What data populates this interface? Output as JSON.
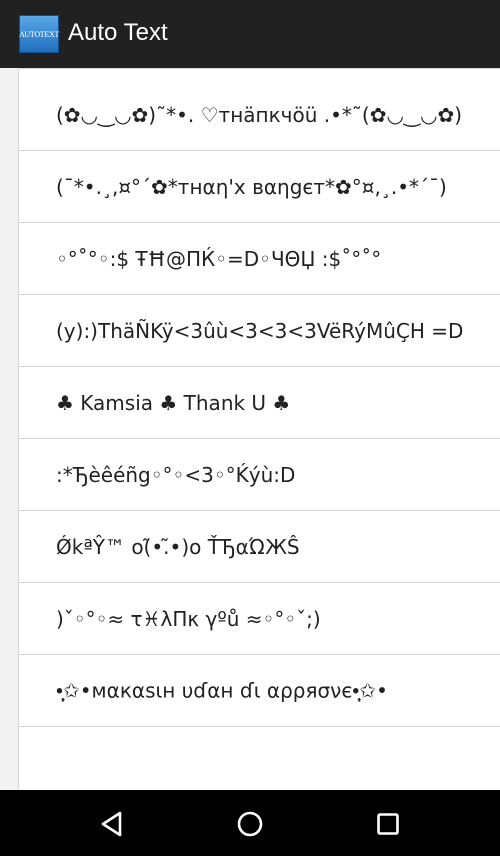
{
  "app": {
    "title": "Auto Text",
    "icon_label": "AUTOTEXT"
  },
  "items": [
    {
      "text": "(✿◡‿◡✿)˜*•. ♡тнäпкчöü .•*˜(✿◡‿◡✿)"
    },
    {
      "text": "(¯*•.¸,¤°´✿*тнαη'x вαηgєт*✿°¤,¸.•*´¯)"
    },
    {
      "text": "◦°˚°◦:$ ŦĦ@ΠЌ◦=D◦ЧΘЏ :$˚°˚°"
    },
    {
      "text": "(y):)ThäÑKÿ<3ûù<3<3<3VëRýMûÇH =D"
    },
    {
      "text": "♣ Kamsia ♣ Thank U ♣"
    },
    {
      "text": ":*Ђèêéñg◦°◦<3◦°Ḱýù:D"
    },
    {
      "text": "ǾkªŶ™ o(̃•.̃•)o ŤЂαΏЖŜ"
    },
    {
      "text": ")ˇ◦°◦≈ τ♓λΠκ γºů ≈◦°◦ˇ;)"
    },
    {
      "text": "•̩̩͙✩•мαкαѕιн υɗαн ɗι αρρяσνє•̩̩͙✩•"
    }
  ],
  "navigation": {
    "back_icon": "back-triangle",
    "home_icon": "home-circle",
    "recents_icon": "recents-square"
  },
  "colors": {
    "appbar": "#212121",
    "list_background": "#ffffff",
    "page_background": "#f2f2f2",
    "divider": "#d6d6d6",
    "navbar": "#000000"
  }
}
